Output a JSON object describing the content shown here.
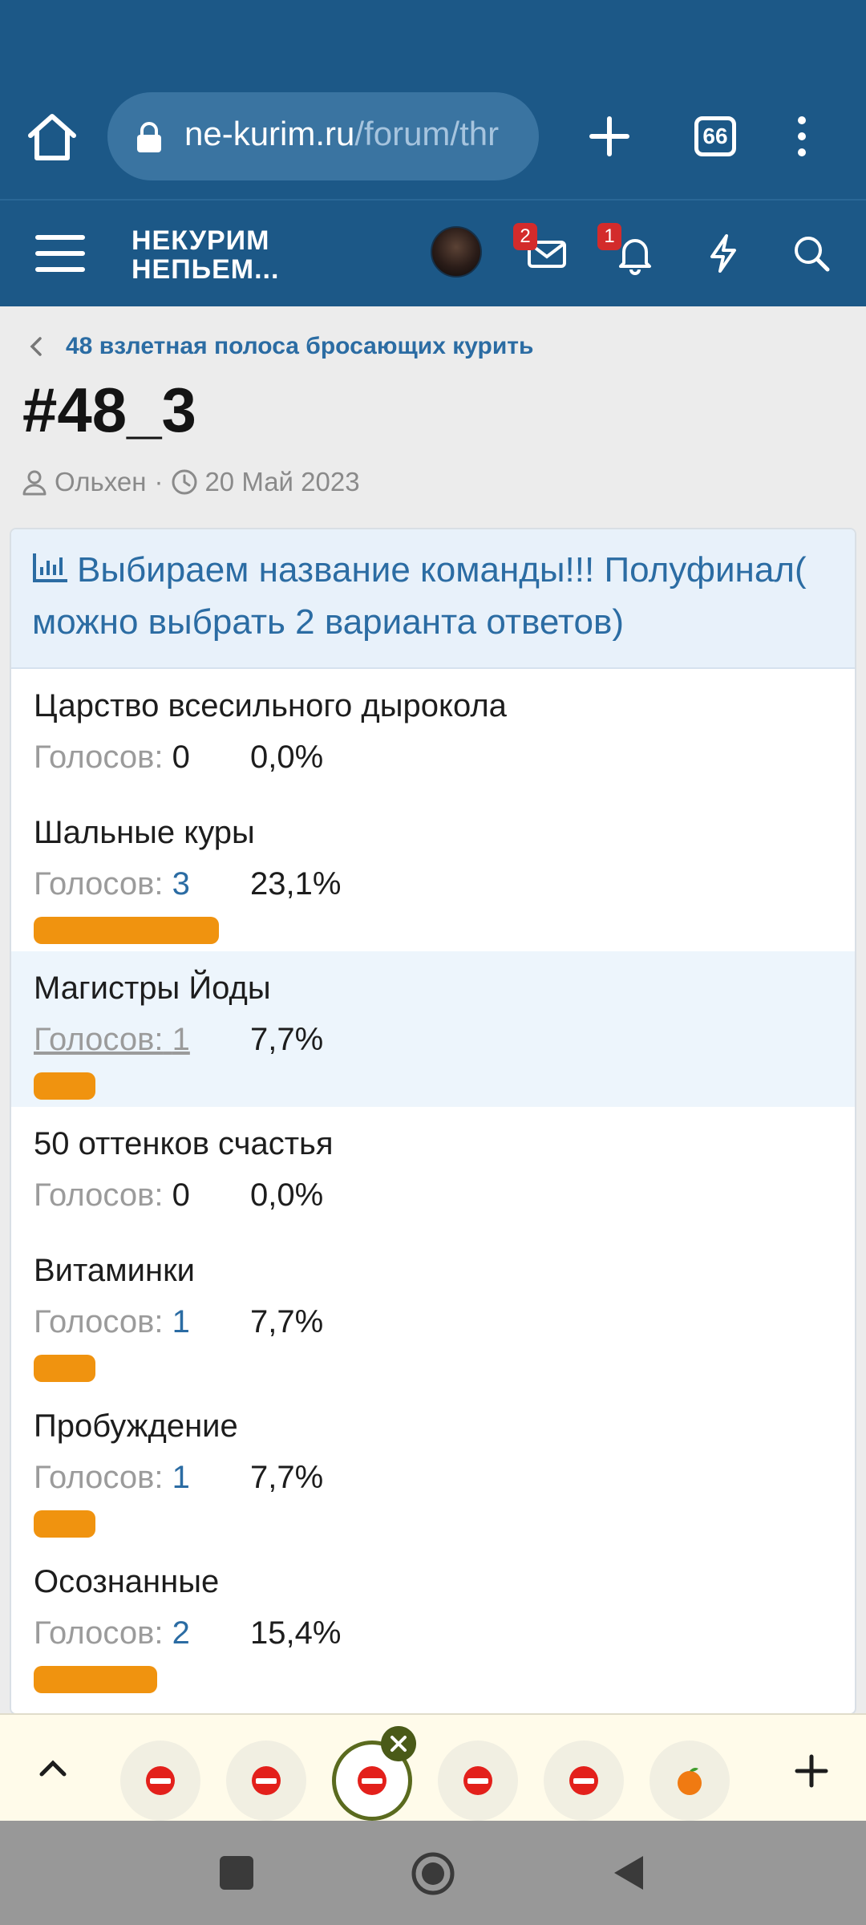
{
  "browser": {
    "url_domain": "ne-kurim.ru",
    "url_path": "/forum/thr",
    "tabs_count": "66"
  },
  "site": {
    "logo_line1": "НЕКУРИМ",
    "logo_line2": "НЕПЬЕМ...",
    "mail_badge": "2",
    "bell_badge": "1"
  },
  "thread": {
    "breadcrumb": "48 взлетная полоса бросающих курить",
    "title": "#48_3",
    "author": "Ольхен",
    "separator": "·",
    "date": "20 Май 2023"
  },
  "poll": {
    "question": "Выбираем название команды!!! Полуфинал( можно выбрать 2 варианта ответов)",
    "votes_label": "Голосов:",
    "options": [
      {
        "label": "Царство всесильного дырокола",
        "votes": "0",
        "percent": "0,0%",
        "share": 0.0
      },
      {
        "label": "Шальные куры",
        "votes": "3",
        "percent": "23,1%",
        "share": 0.231
      },
      {
        "label": "Магистры Йоды",
        "votes": "1",
        "percent": "7,7%",
        "share": 0.077
      },
      {
        "label": "50 оттенков счастья",
        "votes": "0",
        "percent": "0,0%",
        "share": 0.0
      },
      {
        "label": "Витаминки",
        "votes": "1",
        "percent": "7,7%",
        "share": 0.077
      },
      {
        "label": "Пробуждение",
        "votes": "1",
        "percent": "7,7%",
        "share": 0.077
      },
      {
        "label": "Осознанные",
        "votes": "2",
        "percent": "15,4%",
        "share": 0.154
      }
    ]
  },
  "colors": {
    "header_blue": "#1c5887",
    "link_blue": "#2b6ca3",
    "bar_orange": "#f0930f",
    "highlight_row": "#edf5fc"
  }
}
